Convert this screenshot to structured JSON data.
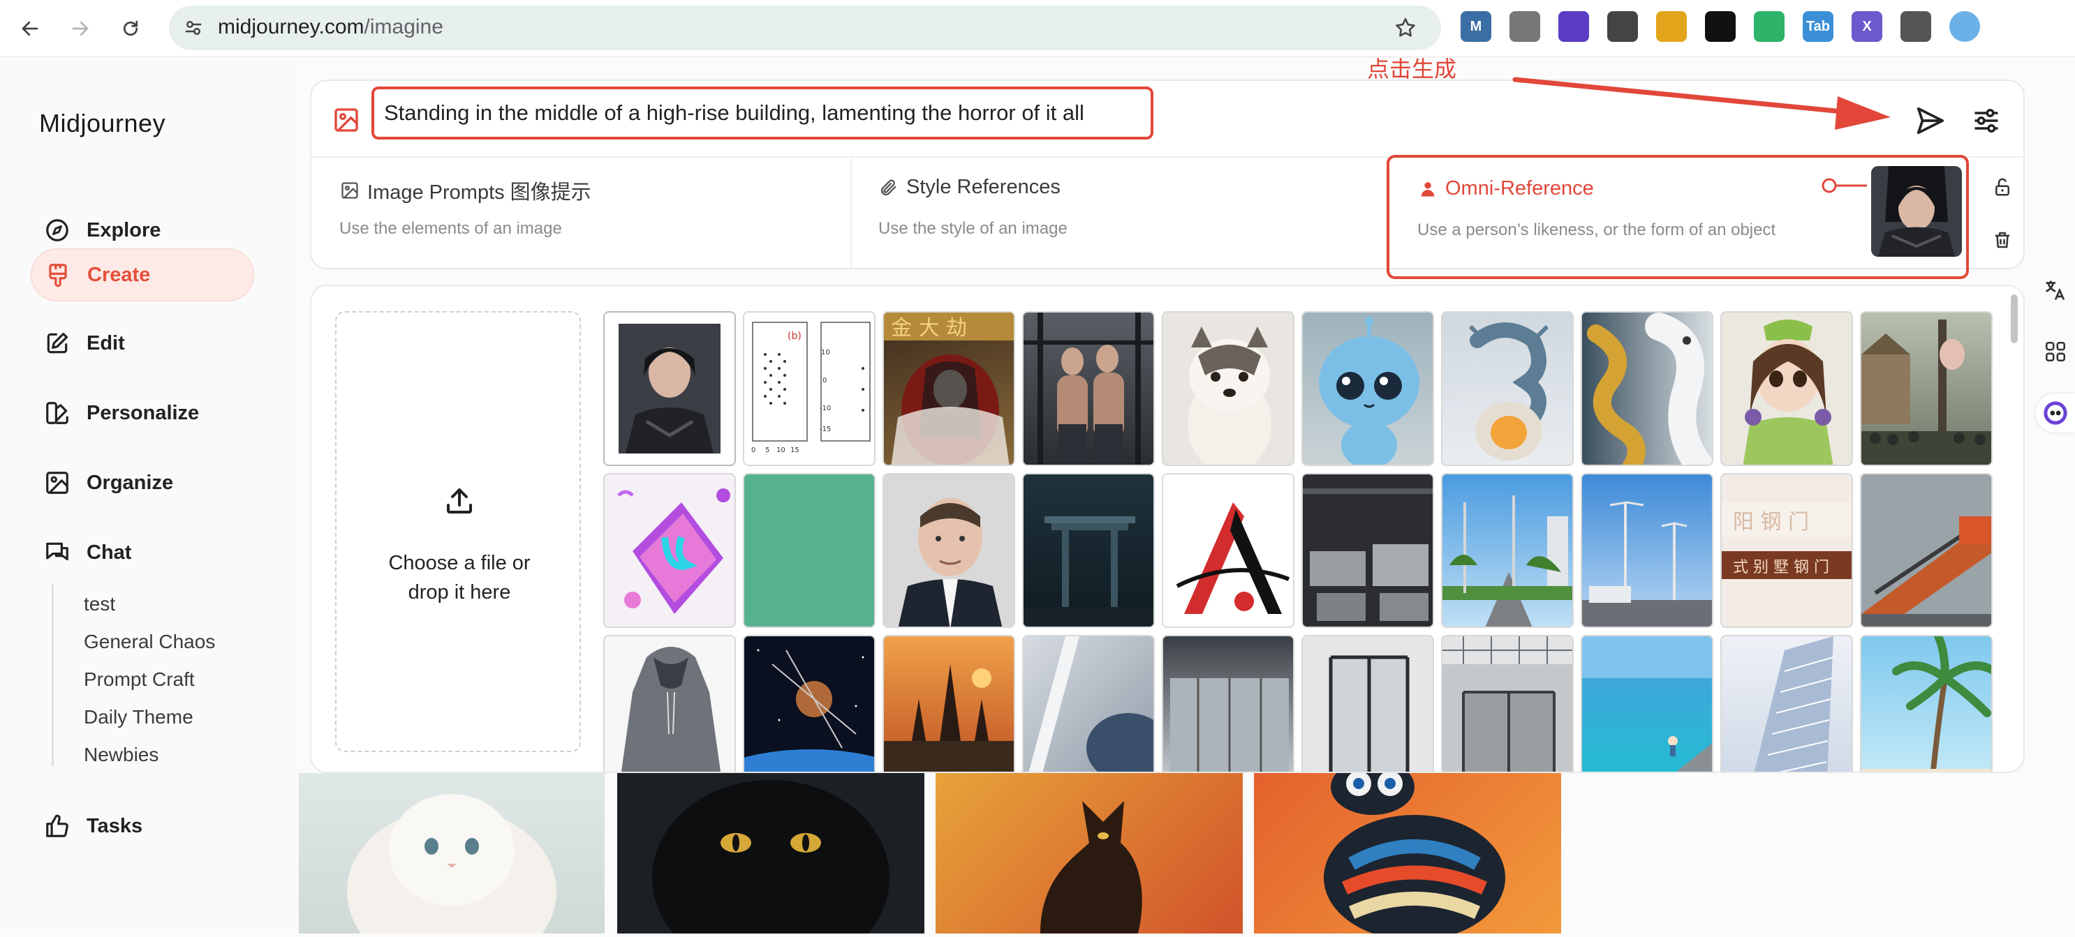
{
  "browser": {
    "url_host": "midjourney.com",
    "url_path": "/imagine",
    "extensions": [
      {
        "name": "markdown-ext-icon",
        "label": "M",
        "color": "#3a6ea5"
      },
      {
        "name": "copy-ext-icon",
        "label": "",
        "color": "#777777"
      },
      {
        "name": "monica-ext-icon",
        "label": "",
        "color": "#5b3cc4"
      },
      {
        "name": "qr-ext-icon",
        "label": "",
        "color": "#444444"
      },
      {
        "name": "cat-ext-icon",
        "label": "",
        "color": "#e3a51c"
      },
      {
        "name": "glasses-ext-icon",
        "label": "",
        "color": "#111111"
      },
      {
        "name": "shield-ext-icon",
        "label": "",
        "color": "#2fb36a"
      },
      {
        "name": "tab-ext-icon",
        "label": "Tab",
        "color": "#3b8fd6"
      },
      {
        "name": "x-ext-icon",
        "label": "X",
        "color": "#6a5acd"
      },
      {
        "name": "puzzle-ext-icon",
        "label": "",
        "color": "#555555"
      },
      {
        "name": "profile-avatar-icon",
        "label": "",
        "color": "#6cb0e8"
      }
    ]
  },
  "sidebar": {
    "brand": "Midjourney",
    "items": [
      {
        "label": "Explore",
        "icon": "compass-icon"
      },
      {
        "label": "Create",
        "icon": "brush-icon",
        "active": true
      },
      {
        "label": "Edit",
        "icon": "edit-icon"
      },
      {
        "label": "Personalize",
        "icon": "personalize-icon"
      },
      {
        "label": "Organize",
        "icon": "image-icon"
      },
      {
        "label": "Chat",
        "icon": "chat-icon"
      }
    ],
    "chat_rooms": [
      "test",
      "General Chaos",
      "Prompt Craft",
      "Daily Theme",
      "Newbies"
    ],
    "tasks_label": "Tasks"
  },
  "prompt": {
    "text": "Standing in the middle of a high-rise building, lamenting the horror of it all"
  },
  "references": {
    "image_prompts": {
      "title": "Image Prompts 图像提示",
      "desc": "Use the elements of an image"
    },
    "style_references": {
      "title": "Style References",
      "desc": "Use the style of an image"
    },
    "omni_reference": {
      "title": "Omni-Reference",
      "desc": "Use a person’s likeness, or the form of an object"
    }
  },
  "annotation": {
    "text": "点击生成"
  },
  "picker": {
    "dropzone_line1": "Choose a file or",
    "dropzone_line2": "drop it here"
  },
  "colors": {
    "accent": "#e2473a",
    "active_bg": "#fde9e6"
  }
}
